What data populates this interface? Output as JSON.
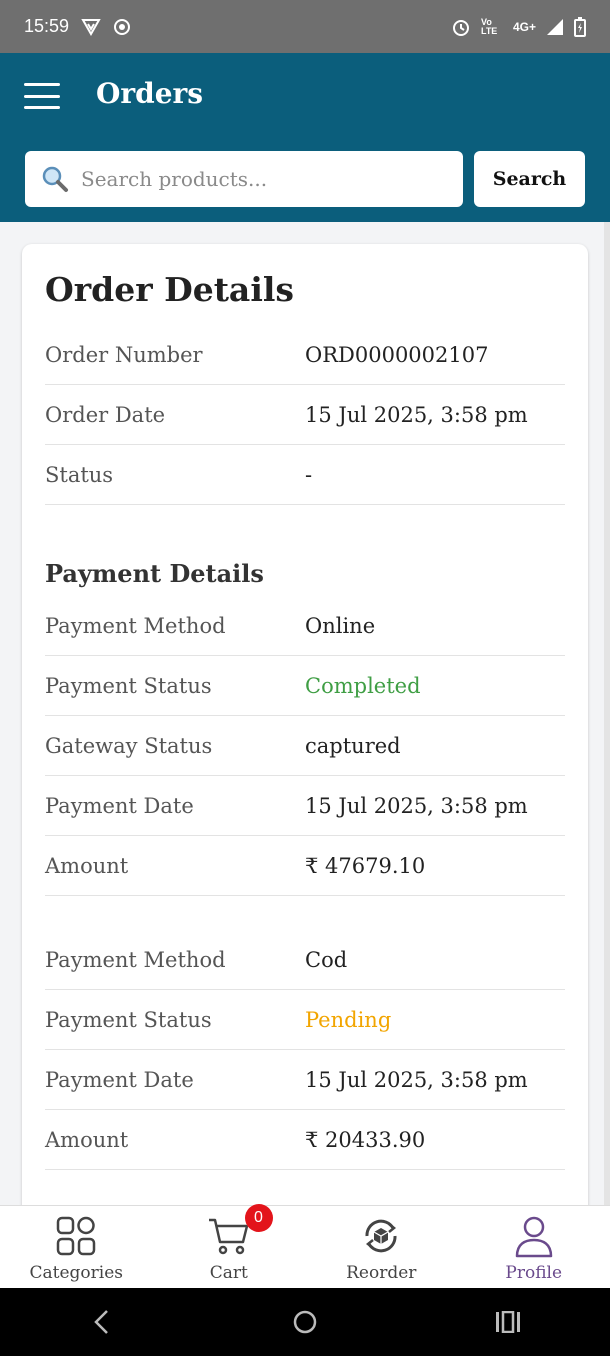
{
  "status_bar": {
    "time": "15:59",
    "network": "4G+",
    "volte": "Vo LTE"
  },
  "header": {
    "title": "Orders"
  },
  "search": {
    "placeholder": "Search products...",
    "button_label": "Search"
  },
  "order_details": {
    "title": "Order Details",
    "rows": [
      {
        "label": "Order Number",
        "value": "ORD0000002107"
      },
      {
        "label": "Order Date",
        "value": "15 Jul 2025, 3:58 pm"
      },
      {
        "label": "Status",
        "value": "-"
      }
    ]
  },
  "payment_details": {
    "title": "Payment Details",
    "payments": [
      {
        "rows": [
          {
            "label": "Payment Method",
            "value": "Online"
          },
          {
            "label": "Payment Status",
            "value": "Completed"
          },
          {
            "label": "Gateway Status",
            "value": "captured"
          },
          {
            "label": "Payment Date",
            "value": "15 Jul 2025, 3:58 pm"
          },
          {
            "label": "Amount",
            "value": "₹ 47679.10"
          }
        ]
      },
      {
        "rows": [
          {
            "label": "Payment Method",
            "value": "Cod"
          },
          {
            "label": "Payment Status",
            "value": "Pending"
          },
          {
            "label": "Payment Date",
            "value": "15 Jul 2025, 3:58 pm"
          },
          {
            "label": "Amount",
            "value": "₹ 20433.90"
          }
        ]
      }
    ]
  },
  "bottom_nav": {
    "items": [
      {
        "label": "Categories",
        "icon": "grid-icon"
      },
      {
        "label": "Cart",
        "icon": "cart-icon",
        "badge": "0"
      },
      {
        "label": "Reorder",
        "icon": "reorder-icon"
      },
      {
        "label": "Profile",
        "icon": "profile-icon"
      }
    ]
  },
  "colors": {
    "header_bg": "#0b5e7c",
    "completed": "#3f9e44",
    "pending": "#f2a500",
    "active_nav": "#6a4a8c",
    "badge": "#e3141b"
  }
}
